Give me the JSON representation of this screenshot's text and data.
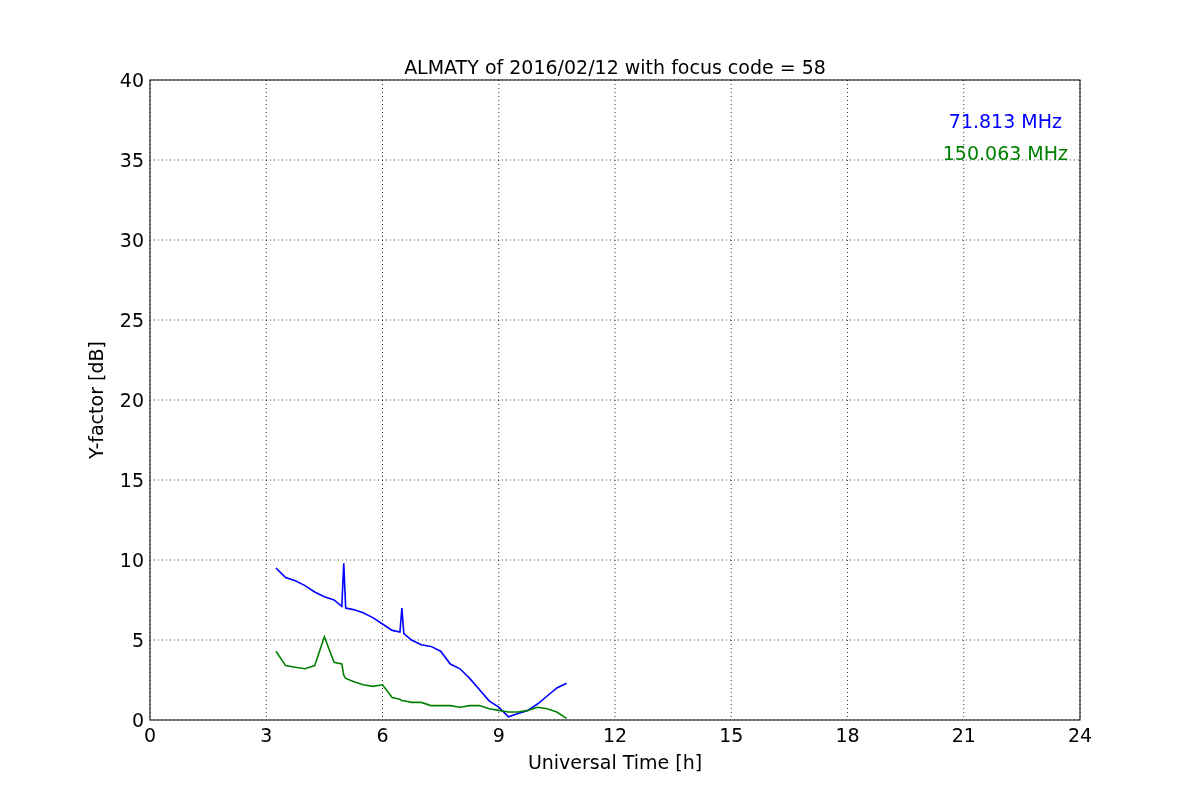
{
  "chart_data": {
    "type": "line",
    "title": "ALMATY of 2016/02/12 with focus code = 58",
    "xlabel": "Universal Time [h]",
    "ylabel": "Y-factor [dB]",
    "x": [
      3.25,
      3.5,
      3.75,
      4,
      4.25,
      4.5,
      4.75,
      4.95,
      5,
      5.05,
      5.25,
      5.5,
      5.75,
      6,
      6.25,
      6.45,
      6.5,
      6.55,
      6.75,
      7,
      7.25,
      7.5,
      7.75,
      8,
      8.25,
      8.5,
      8.75,
      9,
      9.25,
      9.5,
      9.75,
      10,
      10.25,
      10.5,
      10.75
    ],
    "grid": true,
    "xlim": [
      0,
      24
    ],
    "ylim": [
      0,
      40
    ],
    "xticks": [
      0,
      3,
      6,
      9,
      12,
      15,
      18,
      21,
      24
    ],
    "yticks": [
      0,
      5,
      10,
      15,
      20,
      25,
      30,
      35,
      40
    ],
    "series": [
      {
        "name": "71.813 MHz",
        "color": "#0000ff",
        "values": [
          9.5,
          8.9,
          8.7,
          8.4,
          8.0,
          7.7,
          7.5,
          7.1,
          9.8,
          7.0,
          6.9,
          6.7,
          6.4,
          6.0,
          5.6,
          5.5,
          7.0,
          5.4,
          5.0,
          4.7,
          4.6,
          4.3,
          3.5,
          3.2,
          2.6,
          1.9,
          1.2,
          0.8,
          0.2,
          0.4,
          0.6,
          1.0,
          1.5,
          2.0,
          2.3
        ]
      },
      {
        "name": "150.063 MHz",
        "color": "#008000",
        "values": [
          4.3,
          3.4,
          3.3,
          3.2,
          3.4,
          5.2,
          3.6,
          3.5,
          2.8,
          2.6,
          2.4,
          2.2,
          2.1,
          2.2,
          1.4,
          1.3,
          1.2,
          1.2,
          1.1,
          1.1,
          0.9,
          0.9,
          0.9,
          0.8,
          0.9,
          0.9,
          0.7,
          0.6,
          0.5,
          0.5,
          0.6,
          0.8,
          0.7,
          0.5,
          0.1
        ]
      }
    ]
  }
}
